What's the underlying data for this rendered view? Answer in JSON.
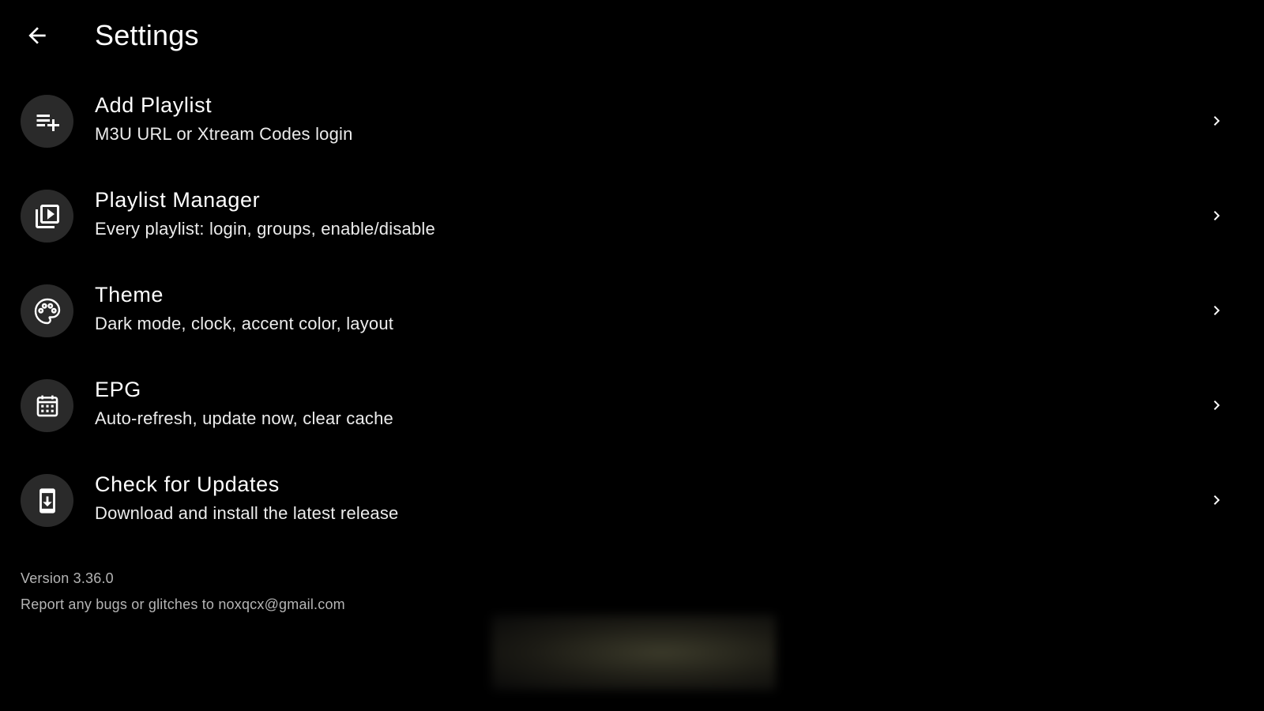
{
  "header": {
    "back_icon": "arrow-left-icon",
    "title": "Settings"
  },
  "settings": {
    "items": [
      {
        "icon": "playlist-add-icon",
        "title": "Add Playlist",
        "subtitle": "M3U URL or Xtream Codes login"
      },
      {
        "icon": "video-library-icon",
        "title": "Playlist Manager",
        "subtitle": "Every playlist: login, groups, enable/disable"
      },
      {
        "icon": "palette-icon",
        "title": "Theme",
        "subtitle": "Dark mode, clock, accent color, layout"
      },
      {
        "icon": "calendar-icon",
        "title": "EPG",
        "subtitle": "Auto-refresh, update now, clear cache"
      },
      {
        "icon": "system-update-icon",
        "title": "Check for Updates",
        "subtitle": "Download and install the latest release"
      }
    ]
  },
  "footer": {
    "version": "Version 3.36.0",
    "report": "Report any bugs or glitches to noxqcx@gmail.com"
  },
  "colors": {
    "background": "#000000",
    "icon_circle": "#2a2a2a",
    "text_primary": "#ffffff",
    "text_secondary": "#b5b5b5"
  }
}
